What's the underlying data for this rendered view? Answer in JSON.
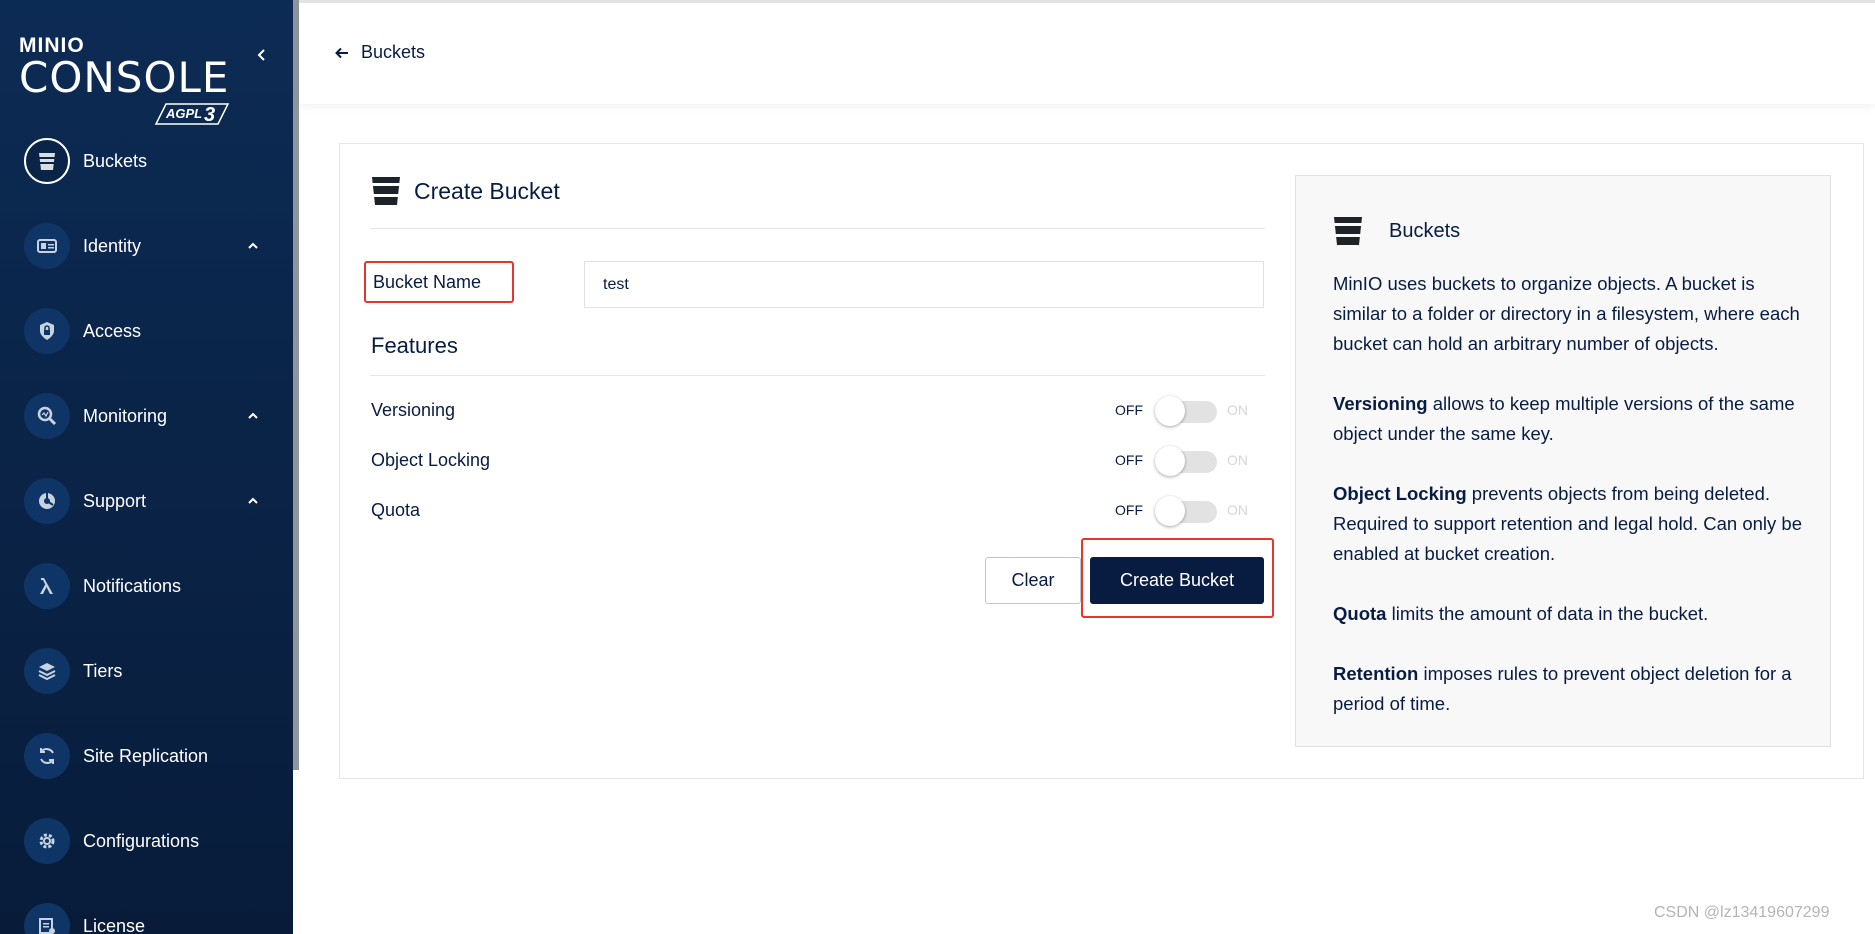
{
  "brand": {
    "top": "MINIO",
    "main": "CONSOLE",
    "license_badge": "AGPLv3"
  },
  "sidebar": {
    "items": [
      {
        "label": "Buckets",
        "icon": "bucket-icon",
        "active": true,
        "expandable": false
      },
      {
        "label": "Identity",
        "icon": "id-card-icon",
        "active": false,
        "expandable": true
      },
      {
        "label": "Access",
        "icon": "lock-icon",
        "active": false,
        "expandable": false
      },
      {
        "label": "Monitoring",
        "icon": "magnifier-icon",
        "active": false,
        "expandable": true
      },
      {
        "label": "Support",
        "icon": "support-icon",
        "active": false,
        "expandable": true
      },
      {
        "label": "Notifications",
        "icon": "lambda-icon",
        "active": false,
        "expandable": false
      },
      {
        "label": "Tiers",
        "icon": "layers-icon",
        "active": false,
        "expandable": false
      },
      {
        "label": "Site Replication",
        "icon": "sync-icon",
        "active": false,
        "expandable": false
      },
      {
        "label": "Configurations",
        "icon": "gear-icon",
        "active": false,
        "expandable": false
      },
      {
        "label": "License",
        "icon": "license-icon",
        "active": false,
        "expandable": false
      }
    ]
  },
  "header": {
    "back_label": "Buckets",
    "back_icon": "arrow-left-icon"
  },
  "form": {
    "title": "Create Bucket",
    "bucket_name_label": "Bucket Name",
    "bucket_name_value": "test",
    "features_title": "Features",
    "features": [
      {
        "label": "Versioning",
        "off": "OFF",
        "on": "ON",
        "enabled": false
      },
      {
        "label": "Object Locking",
        "off": "OFF",
        "on": "ON",
        "enabled": false
      },
      {
        "label": "Quota",
        "off": "OFF",
        "on": "ON",
        "enabled": false
      }
    ],
    "clear_label": "Clear",
    "create_label": "Create Bucket"
  },
  "help": {
    "title": "Buckets",
    "intro": "MinIO uses buckets to organize objects. A bucket is similar to a folder or directory in a filesystem, where each bucket can hold an arbitrary number of objects.",
    "items": [
      {
        "term": "Versioning",
        "text": " allows to keep multiple versions of the same object under the same key."
      },
      {
        "term": "Object Locking",
        "text": " prevents objects from being deleted. Required to support retention and legal hold. Can only be enabled at bucket creation."
      },
      {
        "term": "Quota",
        "text": " limits the amount of data in the bucket."
      },
      {
        "term": "Retention",
        "text": " imposes rules to prevent object deletion for a period of time."
      }
    ]
  },
  "watermark": "CSDN @lz13419607299",
  "colors": {
    "sidebar_bg": "#0c2b54",
    "primary": "#081c42",
    "highlight": "#e53530"
  }
}
